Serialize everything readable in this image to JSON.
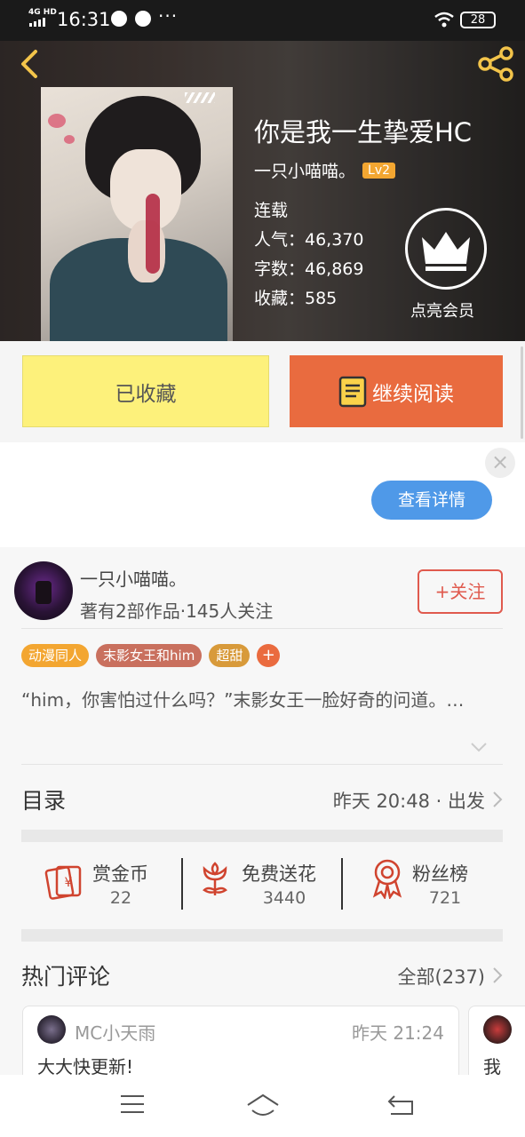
{
  "status": {
    "network": "4G HD",
    "time": "16:31",
    "battery": "28"
  },
  "book": {
    "title": "你是我一生挚爱HC",
    "author": "一只小喵喵。",
    "level": "Lv2",
    "status": "连载",
    "popularity": "人气：46,370",
    "words": "字数：46,869",
    "favorites": "收藏：585",
    "vip_label": "点亮会员"
  },
  "actions": {
    "favorited": "已收藏",
    "continue": "继续阅读"
  },
  "ad": {
    "detail": "查看详情",
    "close": "×"
  },
  "author": {
    "name": "一只小喵喵。",
    "meta": "著有2部作品·145人关注",
    "follow": "+关注"
  },
  "tags": [
    {
      "label": "动漫同人",
      "color": "#f3a631"
    },
    {
      "label": "末影女王和him",
      "color": "#c9705e"
    },
    {
      "label": "超甜",
      "color": "#d89a3a"
    },
    {
      "label": "+",
      "color": "#ea6b3f"
    }
  ],
  "summary": "“him，你害怕过什么吗？”末影女王一脸好奇的问道。…",
  "toc": {
    "title": "目录",
    "update": "昨天 20:48 · 出发"
  },
  "stats": [
    {
      "icon": "red-envelope-icon",
      "label": "赏金币",
      "value": "22"
    },
    {
      "icon": "flower-icon",
      "label": "免费送花",
      "value": "3440"
    },
    {
      "icon": "medal-icon",
      "label": "粉丝榜",
      "value": "721"
    }
  ],
  "comments": {
    "title": "热门评论",
    "all": "全部(237)",
    "items": [
      {
        "user": "MC小天雨",
        "time": "昨天 21:24",
        "text": "大大快更新!"
      },
      {
        "user": "",
        "time": "",
        "text": "我"
      }
    ]
  },
  "colors": {
    "accent_orange": "#e96b3f",
    "fav_yellow": "#fdf17b",
    "blue": "#4f99e8",
    "follow_red": "#e05a4e"
  }
}
